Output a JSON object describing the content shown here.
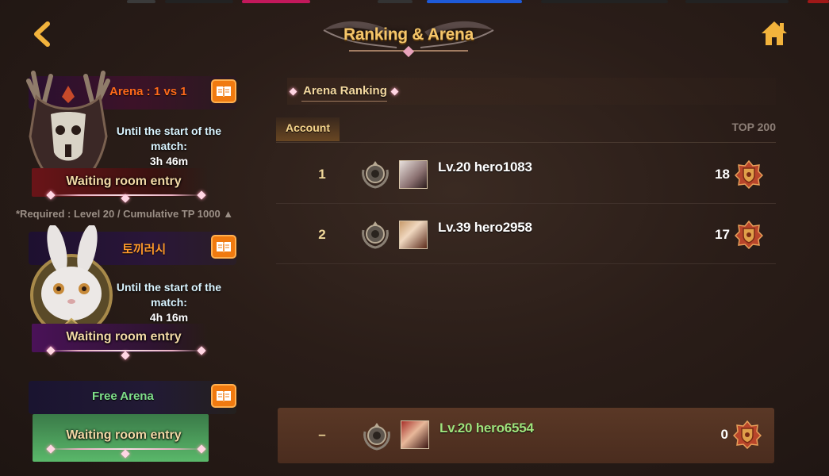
{
  "header": {
    "title": "Ranking & Arena",
    "back_icon": "chevron-left-icon",
    "home_icon": "home-icon"
  },
  "arenas": [
    {
      "name": "Arena : 1 vs 1",
      "countdown_label": "Until the start of the match:",
      "countdown_time": "3h 46m",
      "entry_label": "Waiting room entry",
      "requirement": "*Required : Level 20 / Cumulative TP 1000 ▲",
      "color": "#ff6a1a"
    },
    {
      "name": "토끼러시",
      "countdown_label": "Until the start of the match:",
      "countdown_time": "4h 16m",
      "entry_label": "Waiting room entry",
      "color": "#ff9a2a"
    },
    {
      "name": "Free Arena",
      "entry_label": "Waiting room entry",
      "color": "#7fe08a"
    }
  ],
  "ranking": {
    "tab_label": "Arena Ranking",
    "col_account": "Account",
    "col_top": "TOP 200",
    "rows": [
      {
        "rank": "1",
        "name": "Lv.20 hero1083",
        "score": "18"
      },
      {
        "rank": "2",
        "name": "Lv.39 hero2958",
        "score": "17"
      }
    ],
    "me": {
      "rank": "–",
      "name": "Lv.20 hero6554",
      "score": "0"
    }
  },
  "colors": {
    "accent_gold": "#f5c66a",
    "button_orange": "#f07a10",
    "self_name_green": "#9fe37c"
  }
}
